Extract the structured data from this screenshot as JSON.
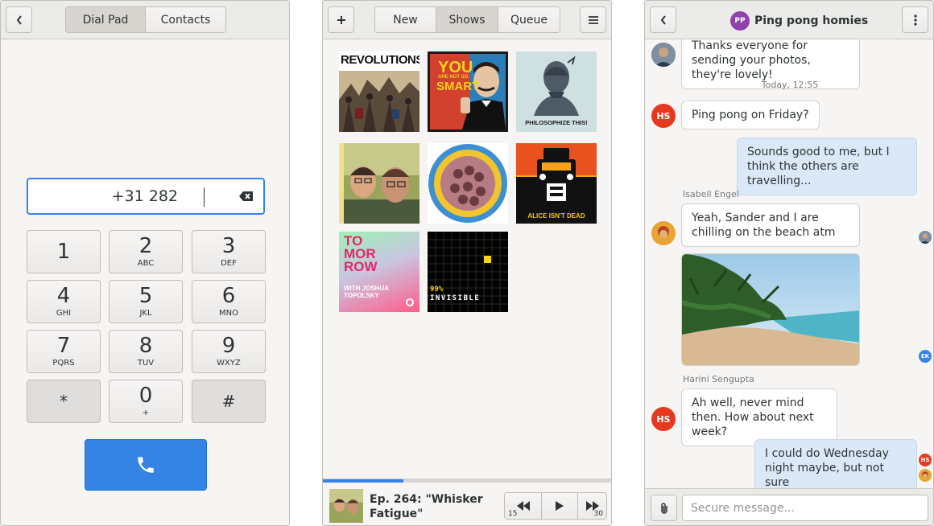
{
  "dialer": {
    "tabs": [
      "Dial Pad",
      "Contacts"
    ],
    "active_tab": "Dial Pad",
    "number": "+31 282",
    "keys": [
      {
        "digit": "1",
        "letters": ""
      },
      {
        "digit": "2",
        "letters": "ABC"
      },
      {
        "digit": "3",
        "letters": "DEF"
      },
      {
        "digit": "4",
        "letters": "GHI"
      },
      {
        "digit": "5",
        "letters": "JKL"
      },
      {
        "digit": "6",
        "letters": "MNO"
      },
      {
        "digit": "7",
        "letters": "PQRS"
      },
      {
        "digit": "8",
        "letters": "TUV"
      },
      {
        "digit": "9",
        "letters": "WXYZ"
      },
      {
        "digit": "*",
        "letters": ""
      },
      {
        "digit": "0",
        "letters": "+"
      },
      {
        "digit": "#",
        "letters": ""
      }
    ],
    "accent": "#3584e4"
  },
  "podcasts": {
    "tabs": [
      "New",
      "Shows",
      "Queue"
    ],
    "active_tab": "Shows",
    "covers": [
      {
        "name": "revolutions",
        "text": "REVOLUTIONS"
      },
      {
        "name": "you-are-not-so-smart",
        "text": "YOU",
        "text2": "ARE NOT SO",
        "text3": "SMART"
      },
      {
        "name": "philosophize-this",
        "text": "PHILOSOPHIZE THIS!"
      },
      {
        "name": "photo-portrait",
        "text": ""
      },
      {
        "name": "circle-group-photo",
        "text": ""
      },
      {
        "name": "alice-isnt-dead",
        "text": "ALICE ISN'T DEAD"
      },
      {
        "name": "tomorrow",
        "text": "TO",
        "text2": "MOR",
        "text3": "ROW",
        "text4": "WITH JOSHUA TOPOLSKY"
      },
      {
        "name": "99-invisible",
        "text": "99%",
        "text2": "INVISIBLE"
      }
    ],
    "player": {
      "episode_title": "Ep. 264: \"Whisker Fatigue\"",
      "progress": 0.28,
      "skip_back": "15",
      "skip_forward": "30"
    }
  },
  "chat": {
    "title": "Ping pong homies",
    "group_initials": "PP",
    "timestamp": "Today, 12:55",
    "messages": [
      {
        "text": "Thanks everyone for sending your photos, they're lovely!"
      },
      {
        "text": "Ping pong on Friday?",
        "initials": "HS"
      },
      {
        "text": "Sounds good to me, but I think the others are travelling..."
      },
      {
        "sender": "Isabell Engel",
        "text": "Yeah, Sander and I are chilling on the beach atm"
      },
      {
        "sender": "Harini Sengupta",
        "text": "Ah well, never mind then. How about next week?",
        "initials": "HS"
      },
      {
        "text": "I could do Wednesday night maybe, but not sure"
      }
    ],
    "read_receipts": [
      "EK",
      "HS"
    ],
    "composer_placeholder": "Secure message...",
    "colors": {
      "hs": "#e5391f",
      "ek": "#3584e4",
      "pp": "#9141ac"
    }
  }
}
